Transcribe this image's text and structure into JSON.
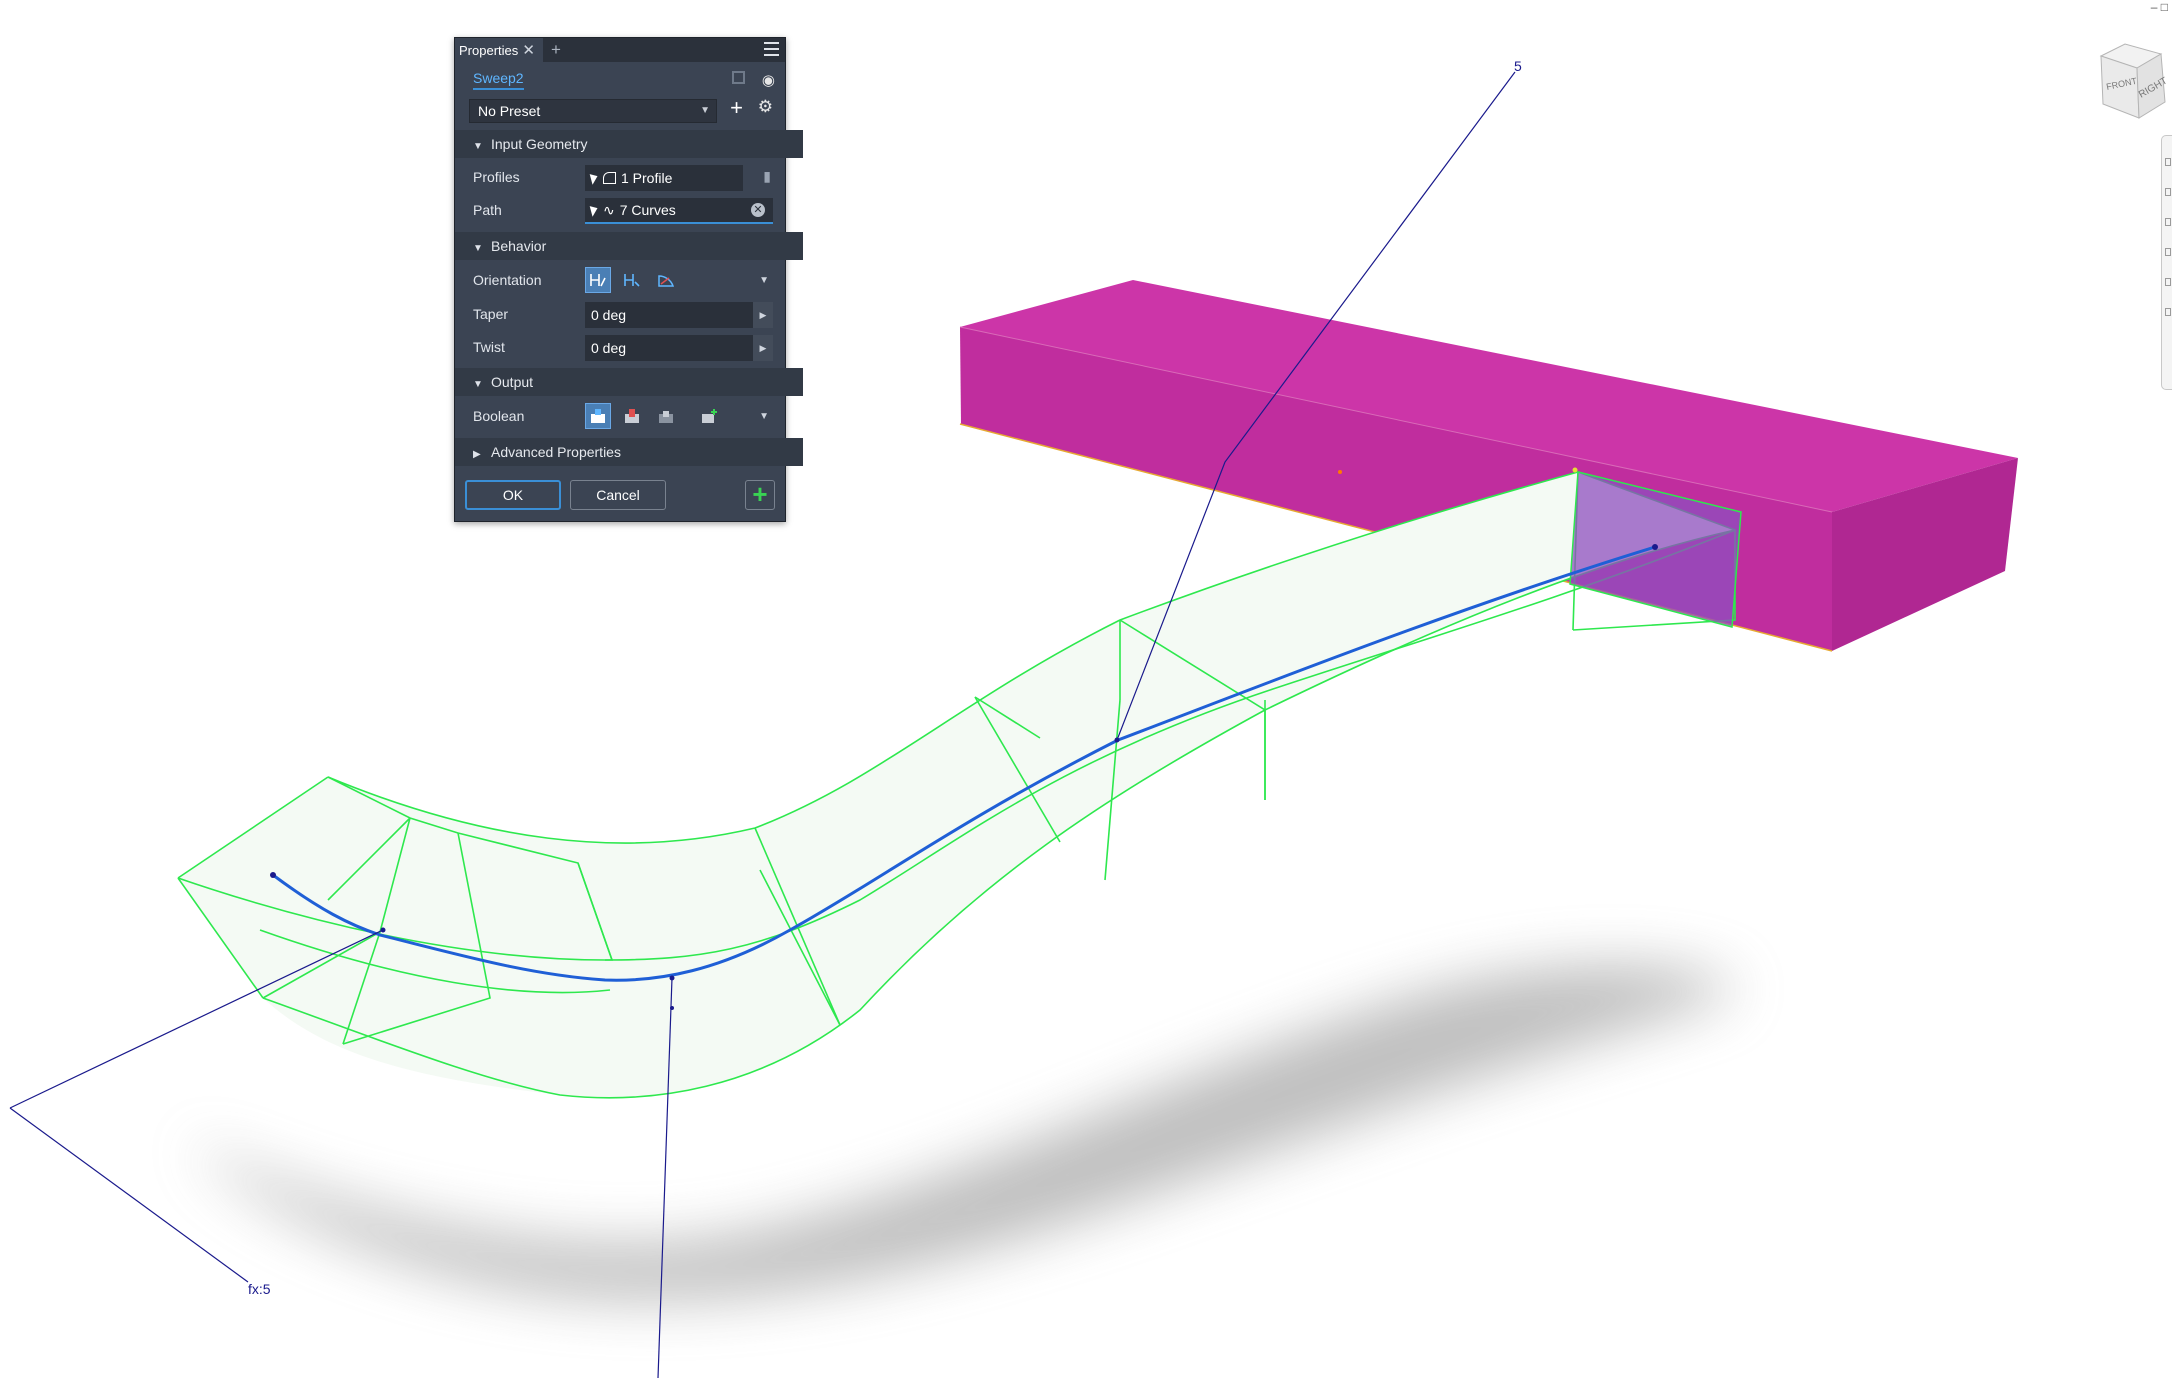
{
  "panel": {
    "tab_label": "Properties",
    "tab_close": "✕",
    "tab_add": "+",
    "feature_name": "Sweep2",
    "preset": "No Preset",
    "preset_add": "+",
    "preset_settings": "⚙",
    "sections": {
      "input_geometry": "Input Geometry",
      "behavior": "Behavior",
      "output": "Output",
      "advanced": "Advanced Properties"
    },
    "profiles_label": "Profiles",
    "profiles_value": "1 Profile",
    "path_label": "Path",
    "path_value": "7 Curves",
    "orientation_label": "Orientation",
    "taper_label": "Taper",
    "taper_value": "0 deg",
    "twist_label": "Twist",
    "twist_value": "0 deg",
    "boolean_label": "Boolean",
    "ok_label": "OK",
    "cancel_label": "Cancel",
    "apply_label": "+"
  },
  "annotations": {
    "dim_top": "5",
    "dim_left": "fx:5"
  },
  "viewcube": {
    "right_label": "RIGHT",
    "front_label": "FRONT",
    "window_controls": "– □"
  },
  "colors": {
    "block_top": "#cc35a8",
    "block_front": "#c02d9e",
    "block_side": "#b02792",
    "sweep_edges": "#2ee84e",
    "sweep_fill": "#f4faf4",
    "path": "#1f5fd6",
    "dimension": "#1a1a8c",
    "panel_bg": "#3b4453",
    "accent": "#3a8fd6"
  },
  "icons": [
    "close-icon",
    "add-tab-icon",
    "hamburger-menu-icon",
    "eye-icon",
    "copy-icon",
    "settings-gear-icon",
    "select-cursor-icon",
    "profile-icon",
    "curve-icon",
    "clear-icon",
    "orientation-path-icon",
    "orientation-fixed-icon",
    "orientation-guide-icon",
    "boolean-join-icon",
    "boolean-cut-icon",
    "boolean-intersect-icon",
    "boolean-new-body-icon",
    "view-cube-icon"
  ]
}
